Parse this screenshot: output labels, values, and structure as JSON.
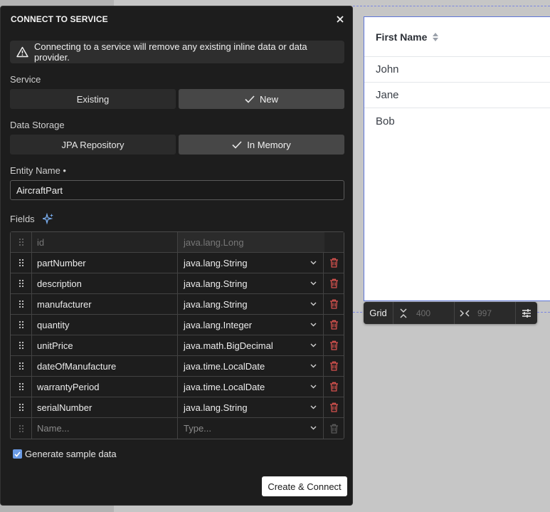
{
  "dialog": {
    "title": "CONNECT TO SERVICE",
    "warning": "Connecting to a service will remove any existing inline data or data provider.",
    "service": {
      "label": "Service",
      "options": [
        "Existing",
        "New"
      ],
      "selected": "New"
    },
    "storage": {
      "label": "Data Storage",
      "options": [
        "JPA Repository",
        "In Memory"
      ],
      "selected": "In Memory"
    },
    "entity": {
      "label": "Entity Name •",
      "value": "AircraftPart"
    },
    "fields": {
      "label": "Fields",
      "rows": [
        {
          "name": "id",
          "type": "java.lang.Long"
        },
        {
          "name": "partNumber",
          "type": "java.lang.String"
        },
        {
          "name": "description",
          "type": "java.lang.String"
        },
        {
          "name": "manufacturer",
          "type": "java.lang.String"
        },
        {
          "name": "quantity",
          "type": "java.lang.Integer"
        },
        {
          "name": "unitPrice",
          "type": "java.math.BigDecimal"
        },
        {
          "name": "dateOfManufacture",
          "type": "java.time.LocalDate"
        },
        {
          "name": "warrantyPeriod",
          "type": "java.time.LocalDate"
        },
        {
          "name": "serialNumber",
          "type": "java.lang.String"
        }
      ],
      "new_name_placeholder": "Name...",
      "new_type_placeholder": "Type..."
    },
    "generate_sample": {
      "label": "Generate sample data",
      "checked": true
    },
    "create_button": "Create & Connect"
  },
  "grid": {
    "column_header": "First Name",
    "rows": [
      "John",
      "Jane",
      "Bob"
    ]
  },
  "grid_toolbar": {
    "label": "Grid",
    "height_value": "400",
    "width_value": "997"
  },
  "colors": {
    "accent": "#6a9be6",
    "delete": "#d9534f",
    "dialog_bg": "#1d1d1d"
  }
}
